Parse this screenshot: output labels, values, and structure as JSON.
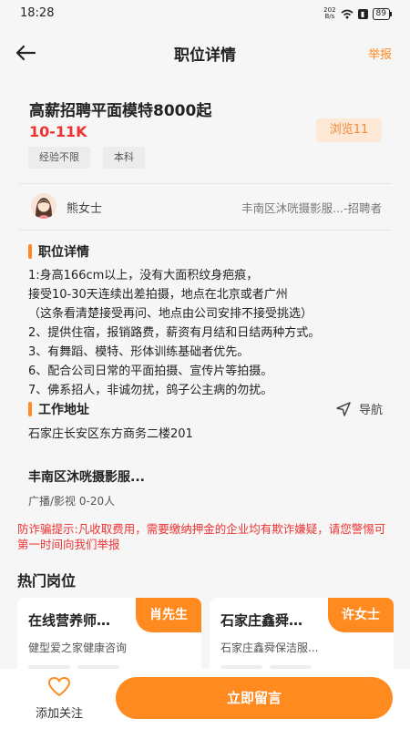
{
  "status": {
    "time": "18:28",
    "net_speed_top": "202",
    "net_speed_bottom": "B/s",
    "battery": "89"
  },
  "nav": {
    "title": "职位详情",
    "report": "举报"
  },
  "job": {
    "title": "高薪招聘平面模特8000起",
    "salary": "10-11K",
    "views": "浏览11",
    "tags": [
      "经验不限",
      "本科"
    ]
  },
  "recruiter": {
    "name": "熊女士",
    "company": "丰南区沐咣摄影服...-招聘者"
  },
  "details": {
    "heading": "职位详情",
    "lines": [
      "1:身高166cm以上，没有大面积纹身疤痕，",
      "接受10-30天连续出差拍摄，地点在北京或者广州",
      "（这条看清楚接受再问、地点由公司安排不接受挑选）",
      "2、提供住宿，报销路费，薪资有月结和日结两种方式。",
      "3、有舞蹈、模特、形体训练基础者优先。",
      "6、配合公司日常的平面拍摄、宣传片等拍摄。",
      "7、佛系招人，非诚勿扰，鸽子公主病的勿扰。"
    ]
  },
  "address": {
    "heading": "工作地址",
    "nav_label": "导航",
    "text": "石家庄长安区东方商务二楼201"
  },
  "company": {
    "name": "丰南区沐咣摄影服...",
    "info": "广播/影视  0-20人"
  },
  "warning": "防诈骗提示:凡收取费用，需要缴纳押金的企业均有欺诈嫌疑，请您警惕可第一时间向我们举报",
  "hot": {
    "heading": "热门岗位",
    "cards": [
      {
        "title": "在线营养师…",
        "contact": "肖先生",
        "desc": "健型爱之家健康咨询"
      },
      {
        "title": "石家庄鑫舜…",
        "contact": "许女士",
        "desc": "石家庄鑫舜保洁服..."
      }
    ]
  },
  "bottom": {
    "follow": "添加关注",
    "cta": "立即留言"
  },
  "colors": {
    "accent": "#ff8a1f",
    "danger": "#ee3333",
    "background": "#f6f6f6"
  }
}
